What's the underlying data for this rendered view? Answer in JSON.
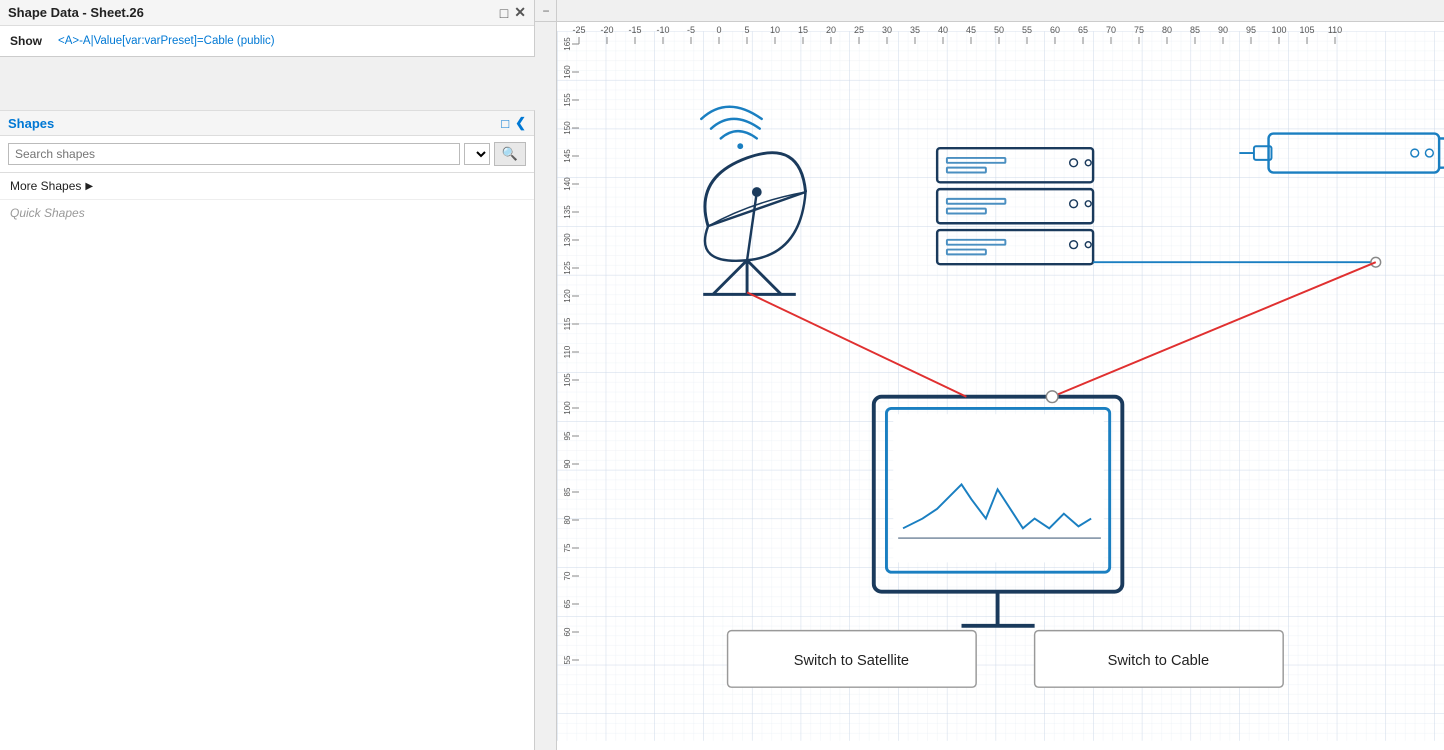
{
  "shapeData": {
    "title": "Shape Data - Sheet.26",
    "showLabel": "Show",
    "showValue": "<A>-A|Value[var:varPreset]=Cable (public)"
  },
  "shapesPanel": {
    "title": "Shapes",
    "searchPlaceholder": "Search shapes",
    "moreShapes": "More Shapes",
    "quickShapes": "Quick Shapes"
  },
  "buttons": {
    "switchToSatellite": "Switch to Satellite",
    "switchToCable": "Switch to Cable"
  },
  "ruler": {
    "minusSymbol": "−",
    "topTicks": [
      "-25",
      "-20",
      "-15",
      "-10",
      "-5",
      "0",
      "5",
      "10",
      "15",
      "20",
      "25",
      "30",
      "35",
      "40",
      "45",
      "50",
      "55",
      "60",
      "65",
      "70",
      "75",
      "80",
      "85",
      "90",
      "95",
      "100",
      "105",
      "110"
    ],
    "leftTicks": [
      "165",
      "160",
      "155",
      "150",
      "145",
      "140",
      "135",
      "130",
      "125",
      "120",
      "115",
      "110",
      "105",
      "100",
      "95",
      "90",
      "85",
      "80",
      "75",
      "70",
      "65",
      "60",
      "55"
    ]
  }
}
